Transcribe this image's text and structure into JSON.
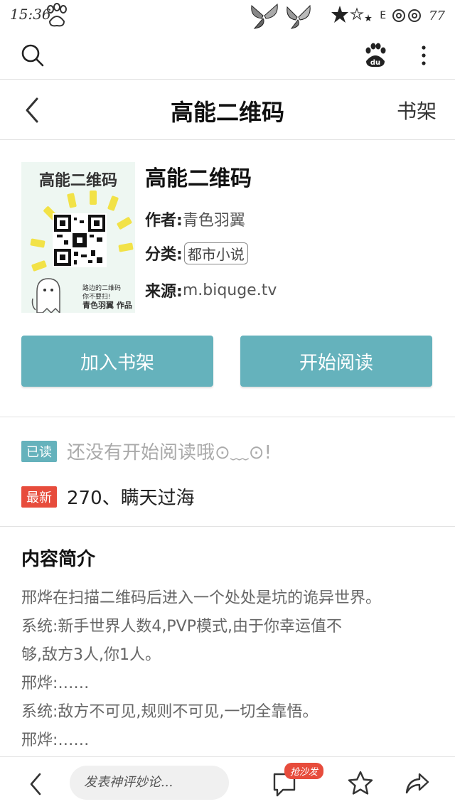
{
  "status_bar": {
    "time": "15:36",
    "signal_text": "E",
    "battery": "77"
  },
  "nav": {
    "title": "高能二维码",
    "shelf_label": "书架"
  },
  "book": {
    "title": "高能二维码",
    "cover_title": "高能二维码",
    "cover_note_lines": [
      "路边的二维码",
      "你不要扫!",
      "青色羽翼 作品"
    ],
    "author_label": "作者:",
    "author": "青色羽翼",
    "category_label": "分类:",
    "category": "都市小说",
    "source_label": "来源:",
    "source": "m.biquge.tv"
  },
  "actions": {
    "add_to_shelf": "加入书架",
    "start_reading": "开始阅读"
  },
  "progress": {
    "read_badge": "已读",
    "read_text": "还没有开始阅读哦⊙﹏⊙!",
    "latest_badge": "最新",
    "latest_text": "270、瞒天过海"
  },
  "intro": {
    "title": "内容简介",
    "lines": [
      "邢烨在扫描二维码后进入一个处处是坑的诡异世界。",
      "系统:新手世界人数4,PVP模式,由于你幸运值不",
      "够,敌方3人,你1人。",
      "邢烨:……",
      "系统:敌方不可见,规则不可见,一切全靠悟。",
      "邢烨:……"
    ]
  },
  "bottom_bar": {
    "comment_placeholder": "发表神评妙论...",
    "hot_badge": "抢沙发"
  },
  "colors": {
    "accent": "#65b2bc",
    "new_badge": "#e74c3c"
  }
}
